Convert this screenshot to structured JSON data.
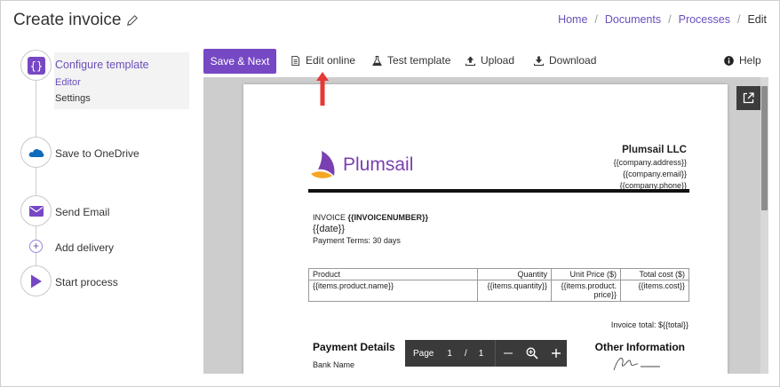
{
  "header": {
    "title": "Create invoice",
    "breadcrumb": [
      "Home",
      "Documents",
      "Processes",
      "Edit"
    ]
  },
  "stepper": {
    "configure": {
      "label": "Configure template",
      "icon": "curly-braces-icon",
      "subitems": [
        "Editor",
        "Settings"
      ]
    },
    "onedrive": {
      "label": "Save to OneDrive",
      "icon": "onedrive-icon"
    },
    "email": {
      "label": "Send Email",
      "icon": "mail-icon"
    },
    "delivery": {
      "label": "Add delivery",
      "icon": "plus-icon"
    },
    "start": {
      "label": "Start process",
      "icon": "play-icon"
    }
  },
  "toolbar": {
    "save_next": "Save & Next",
    "edit_online": "Edit online",
    "test_template": "Test template",
    "upload": "Upload",
    "download": "Download",
    "help": "Help"
  },
  "document": {
    "logo_text": "Plumsail",
    "company": {
      "name": "Plumsail LLC",
      "address": "{{company.address}}",
      "email": "{{company.email}}",
      "phone": "{{company.phone}}"
    },
    "invoice_label": "INVOICE ",
    "invoice_number": "{{INVOICENUMBER}}",
    "date": "{{date}}",
    "payment_terms": "Payment Terms: 30 days",
    "table": {
      "headers": [
        "Product",
        "Quantity",
        "Unit Price ($)",
        "Total cost ($)"
      ],
      "row": [
        "{{items.product.name}}",
        "{{items.quantity}}",
        "{{items.product. price}}",
        "{{items.cost}}"
      ]
    },
    "invoice_total": "Invoice total: ${{total}}",
    "payment_details": "Payment Details",
    "bank_name": "Bank Name",
    "other_information": "Other Information"
  },
  "pager": {
    "page_label": "Page",
    "current": "1",
    "separator": "/",
    "total": "1"
  },
  "colors": {
    "accent": "#7648c4",
    "link": "#6b4fbb",
    "arrow": "#e53935",
    "logo": "#7a3fb0"
  }
}
